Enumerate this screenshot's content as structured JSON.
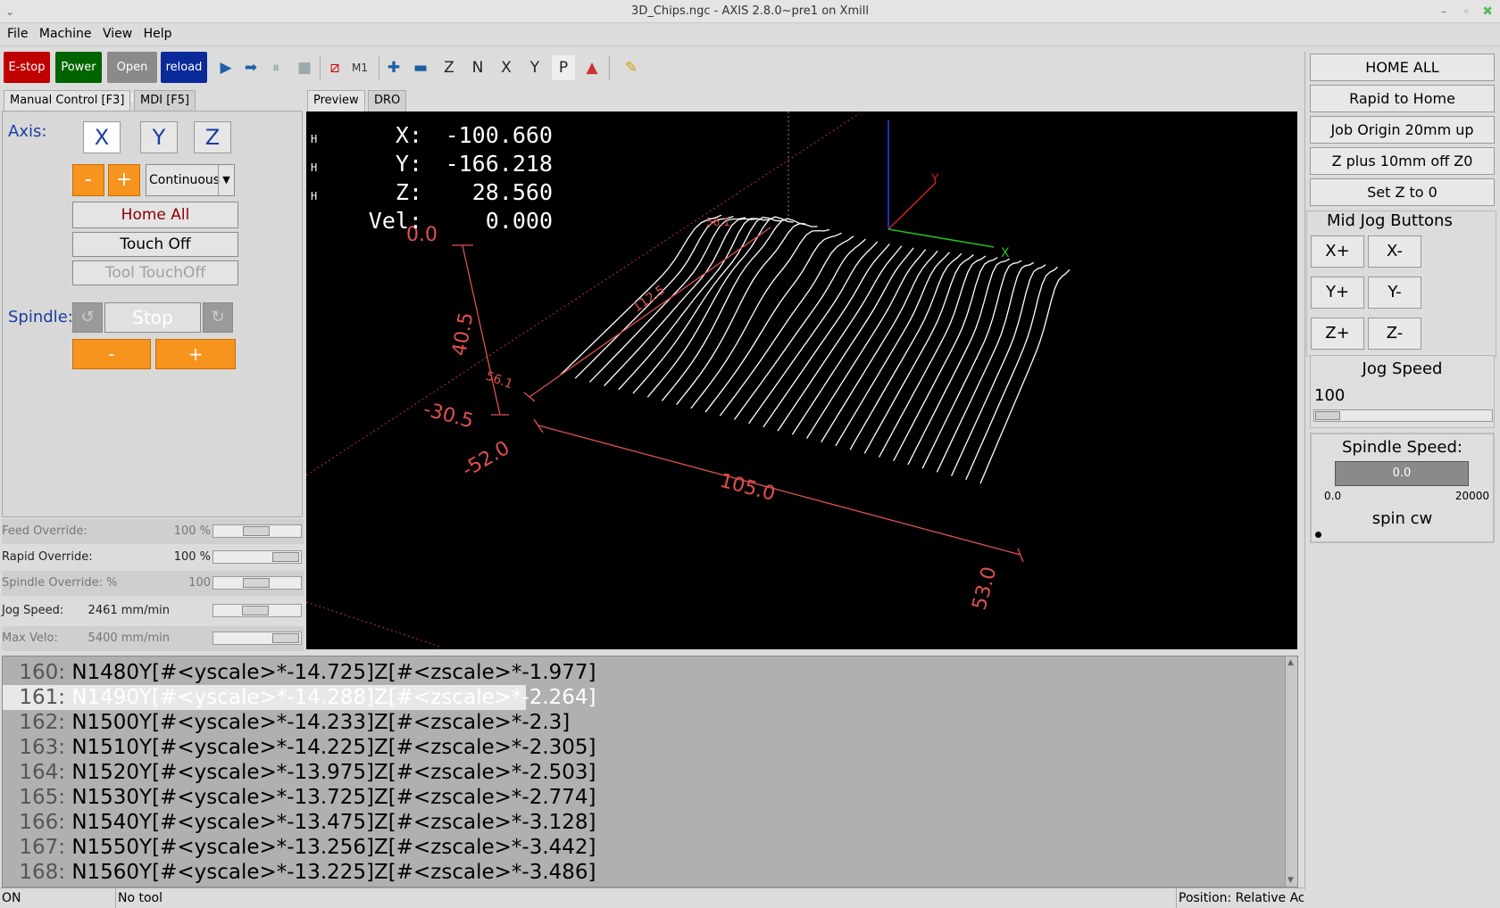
{
  "window": {
    "title": "3D_Chips.ngc - AXIS 2.8.0~pre1 on Xmill"
  },
  "menu": [
    "File",
    "Machine",
    "View",
    "Help"
  ],
  "toolbar": {
    "estop": "E-stop",
    "power": "Power",
    "open": "Open file",
    "reload": "reload"
  },
  "tabs": {
    "manual": "Manual Control [F3]",
    "mdi": "MDI [F5]",
    "preview": "Preview",
    "dro": "DRO"
  },
  "manual": {
    "axis_label": "Axis:",
    "axes": [
      "X",
      "Y",
      "Z"
    ],
    "minus": "-",
    "plus": "+",
    "increment": "Continuous",
    "home_all": "Home All",
    "touch_off": "Touch Off",
    "tool_touchoff": "Tool TouchOff",
    "spindle_label": "Spindle:",
    "spindle_stop": "Stop",
    "spindle_minus": "-",
    "spindle_plus": "+"
  },
  "overrides": [
    {
      "label": "Feed Override:",
      "value": "100 %",
      "level": 0.5
    },
    {
      "label": "Rapid Override:",
      "value": "100 %",
      "level": 1.0
    },
    {
      "label": "Spindle Override: %",
      "value": "100",
      "level": 0.5
    },
    {
      "label": "Jog Speed:",
      "value": "2461 mm/min",
      "level": 0.48
    },
    {
      "label": "Max Velo:",
      "value": "5400 mm/min",
      "level": 1.0
    }
  ],
  "dro": [
    {
      "label": "X:",
      "value": "-100.660",
      "homed": "H"
    },
    {
      "label": "Y:",
      "value": "-166.218",
      "homed": "H"
    },
    {
      "label": "Z:",
      "value": "28.560",
      "homed": "H"
    },
    {
      "label": "Vel:",
      "value": "0.000",
      "homed": ""
    }
  ],
  "preview_dims": [
    "0.0",
    "40.5",
    "-30.5",
    "-52.0",
    "105.0",
    "53.0",
    "112.5",
    "56.1",
    "56.1"
  ],
  "axis_letters": [
    "Y",
    "X"
  ],
  "code": [
    {
      "n": "160:",
      "t": "N1480Y[#<yscale>*-14.725]Z[#<zscale>*-1.977]"
    },
    {
      "n": "161:",
      "t": "N1490Y[#<yscale>*-14.288]Z[#<zscale>*-2.264]"
    },
    {
      "n": "162:",
      "t": "N1500Y[#<yscale>*-14.233]Z[#<zscale>*-2.3]"
    },
    {
      "n": "163:",
      "t": "N1510Y[#<yscale>*-14.225]Z[#<zscale>*-2.305]"
    },
    {
      "n": "164:",
      "t": "N1520Y[#<yscale>*-13.975]Z[#<zscale>*-2.503]"
    },
    {
      "n": "165:",
      "t": "N1530Y[#<yscale>*-13.725]Z[#<zscale>*-2.774]"
    },
    {
      "n": "166:",
      "t": "N1540Y[#<yscale>*-13.475]Z[#<zscale>*-3.128]"
    },
    {
      "n": "167:",
      "t": "N1550Y[#<yscale>*-13.256]Z[#<zscale>*-3.442]"
    },
    {
      "n": "168:",
      "t": "N1560Y[#<yscale>*-13.225]Z[#<zscale>*-3.486]"
    }
  ],
  "status": {
    "state": "ON",
    "tool": "No tool",
    "position": "Position: Relative Ac"
  },
  "right": {
    "buttons": [
      "HOME ALL",
      "Rapid to Home",
      "Job Origin 20mm up",
      "Z plus 10mm off Z0",
      "Set Z to 0"
    ],
    "mid_jog": "Mid Jog Buttons",
    "jog": [
      "X+",
      "X-",
      "Y+",
      "Y-",
      "Z+",
      "Z-"
    ],
    "jog_speed_label": "Jog Speed",
    "jog_speed_value": "100",
    "spindle_speed_label": "Spindle Speed:",
    "spindle_speed_value": "0.0",
    "scale_min": "0.0",
    "scale_max": "20000",
    "spin": "spin cw"
  }
}
